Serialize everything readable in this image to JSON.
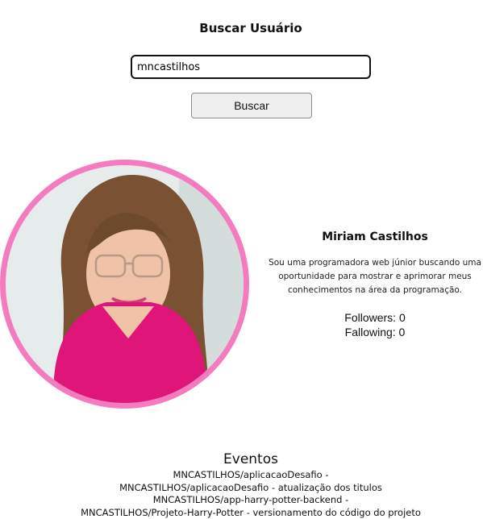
{
  "search": {
    "title": "Buscar Usuário",
    "input_value": "mncastilhos",
    "button_label": "Buscar"
  },
  "profile": {
    "name": "Miriam Castilhos",
    "bio": "Sou uma programadora web júnior buscando uma oportunidade para mostrar e aprimorar meus conhecimentos na área da programação.",
    "followers_text": "Followers: 0",
    "following_text": "Fallowing: 0",
    "avatar_ring_color": "#f47bbf"
  },
  "events": {
    "title": "Eventos",
    "items": [
      "MNCASTILHOS/aplicacaoDesafio -",
      "MNCASTILHOS/aplicacaoDesafio - atualização dos titulos",
      "MNCASTILHOS/app-harry-potter-backend -",
      "MNCASTILHOS/Projeto-Harry-Potter - versionamento do código do projeto"
    ]
  }
}
